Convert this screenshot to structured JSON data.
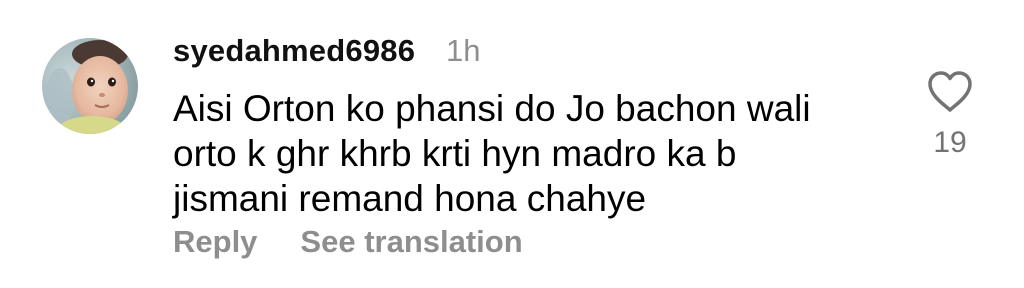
{
  "comment": {
    "username": "syedahmed6986",
    "timestamp": "1h",
    "text_lines": [
      "Aisi Orton ko phansi do Jo bachon wali",
      "orto k ghr khrb krti hyn madro ka b",
      "jismani remand hona chahye"
    ],
    "like_count": "19",
    "reply_label": "Reply",
    "see_translation_label": "See translation",
    "icons": {
      "avatar": "baby-photo-avatar",
      "like": "heart-outline-icon"
    },
    "colors": {
      "username": "#111111",
      "secondary_text": "#8e8e8e",
      "like_count": "#737373"
    }
  }
}
